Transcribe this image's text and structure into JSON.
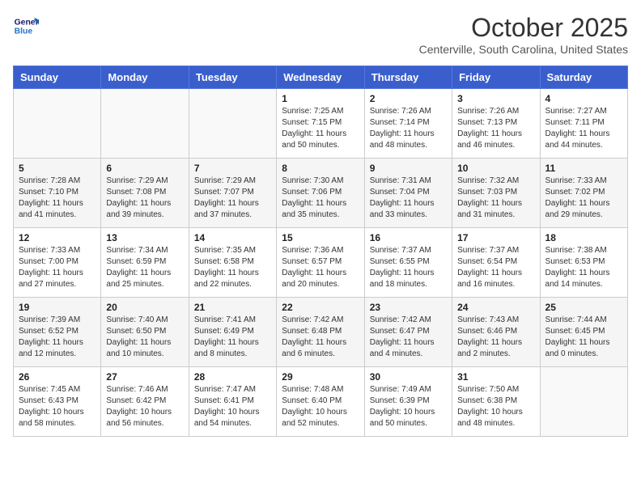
{
  "logo": {
    "line1": "General",
    "line2": "Blue"
  },
  "title": "October 2025",
  "subtitle": "Centerville, South Carolina, United States",
  "days_of_week": [
    "Sunday",
    "Monday",
    "Tuesday",
    "Wednesday",
    "Thursday",
    "Friday",
    "Saturday"
  ],
  "weeks": [
    [
      {
        "day": "",
        "info": ""
      },
      {
        "day": "",
        "info": ""
      },
      {
        "day": "",
        "info": ""
      },
      {
        "day": "1",
        "info": "Sunrise: 7:25 AM\nSunset: 7:15 PM\nDaylight: 11 hours\nand 50 minutes."
      },
      {
        "day": "2",
        "info": "Sunrise: 7:26 AM\nSunset: 7:14 PM\nDaylight: 11 hours\nand 48 minutes."
      },
      {
        "day": "3",
        "info": "Sunrise: 7:26 AM\nSunset: 7:13 PM\nDaylight: 11 hours\nand 46 minutes."
      },
      {
        "day": "4",
        "info": "Sunrise: 7:27 AM\nSunset: 7:11 PM\nDaylight: 11 hours\nand 44 minutes."
      }
    ],
    [
      {
        "day": "5",
        "info": "Sunrise: 7:28 AM\nSunset: 7:10 PM\nDaylight: 11 hours\nand 41 minutes."
      },
      {
        "day": "6",
        "info": "Sunrise: 7:29 AM\nSunset: 7:08 PM\nDaylight: 11 hours\nand 39 minutes."
      },
      {
        "day": "7",
        "info": "Sunrise: 7:29 AM\nSunset: 7:07 PM\nDaylight: 11 hours\nand 37 minutes."
      },
      {
        "day": "8",
        "info": "Sunrise: 7:30 AM\nSunset: 7:06 PM\nDaylight: 11 hours\nand 35 minutes."
      },
      {
        "day": "9",
        "info": "Sunrise: 7:31 AM\nSunset: 7:04 PM\nDaylight: 11 hours\nand 33 minutes."
      },
      {
        "day": "10",
        "info": "Sunrise: 7:32 AM\nSunset: 7:03 PM\nDaylight: 11 hours\nand 31 minutes."
      },
      {
        "day": "11",
        "info": "Sunrise: 7:33 AM\nSunset: 7:02 PM\nDaylight: 11 hours\nand 29 minutes."
      }
    ],
    [
      {
        "day": "12",
        "info": "Sunrise: 7:33 AM\nSunset: 7:00 PM\nDaylight: 11 hours\nand 27 minutes."
      },
      {
        "day": "13",
        "info": "Sunrise: 7:34 AM\nSunset: 6:59 PM\nDaylight: 11 hours\nand 25 minutes."
      },
      {
        "day": "14",
        "info": "Sunrise: 7:35 AM\nSunset: 6:58 PM\nDaylight: 11 hours\nand 22 minutes."
      },
      {
        "day": "15",
        "info": "Sunrise: 7:36 AM\nSunset: 6:57 PM\nDaylight: 11 hours\nand 20 minutes."
      },
      {
        "day": "16",
        "info": "Sunrise: 7:37 AM\nSunset: 6:55 PM\nDaylight: 11 hours\nand 18 minutes."
      },
      {
        "day": "17",
        "info": "Sunrise: 7:37 AM\nSunset: 6:54 PM\nDaylight: 11 hours\nand 16 minutes."
      },
      {
        "day": "18",
        "info": "Sunrise: 7:38 AM\nSunset: 6:53 PM\nDaylight: 11 hours\nand 14 minutes."
      }
    ],
    [
      {
        "day": "19",
        "info": "Sunrise: 7:39 AM\nSunset: 6:52 PM\nDaylight: 11 hours\nand 12 minutes."
      },
      {
        "day": "20",
        "info": "Sunrise: 7:40 AM\nSunset: 6:50 PM\nDaylight: 11 hours\nand 10 minutes."
      },
      {
        "day": "21",
        "info": "Sunrise: 7:41 AM\nSunset: 6:49 PM\nDaylight: 11 hours\nand 8 minutes."
      },
      {
        "day": "22",
        "info": "Sunrise: 7:42 AM\nSunset: 6:48 PM\nDaylight: 11 hours\nand 6 minutes."
      },
      {
        "day": "23",
        "info": "Sunrise: 7:42 AM\nSunset: 6:47 PM\nDaylight: 11 hours\nand 4 minutes."
      },
      {
        "day": "24",
        "info": "Sunrise: 7:43 AM\nSunset: 6:46 PM\nDaylight: 11 hours\nand 2 minutes."
      },
      {
        "day": "25",
        "info": "Sunrise: 7:44 AM\nSunset: 6:45 PM\nDaylight: 11 hours\nand 0 minutes."
      }
    ],
    [
      {
        "day": "26",
        "info": "Sunrise: 7:45 AM\nSunset: 6:43 PM\nDaylight: 10 hours\nand 58 minutes."
      },
      {
        "day": "27",
        "info": "Sunrise: 7:46 AM\nSunset: 6:42 PM\nDaylight: 10 hours\nand 56 minutes."
      },
      {
        "day": "28",
        "info": "Sunrise: 7:47 AM\nSunset: 6:41 PM\nDaylight: 10 hours\nand 54 minutes."
      },
      {
        "day": "29",
        "info": "Sunrise: 7:48 AM\nSunset: 6:40 PM\nDaylight: 10 hours\nand 52 minutes."
      },
      {
        "day": "30",
        "info": "Sunrise: 7:49 AM\nSunset: 6:39 PM\nDaylight: 10 hours\nand 50 minutes."
      },
      {
        "day": "31",
        "info": "Sunrise: 7:50 AM\nSunset: 6:38 PM\nDaylight: 10 hours\nand 48 minutes."
      },
      {
        "day": "",
        "info": ""
      }
    ]
  ]
}
